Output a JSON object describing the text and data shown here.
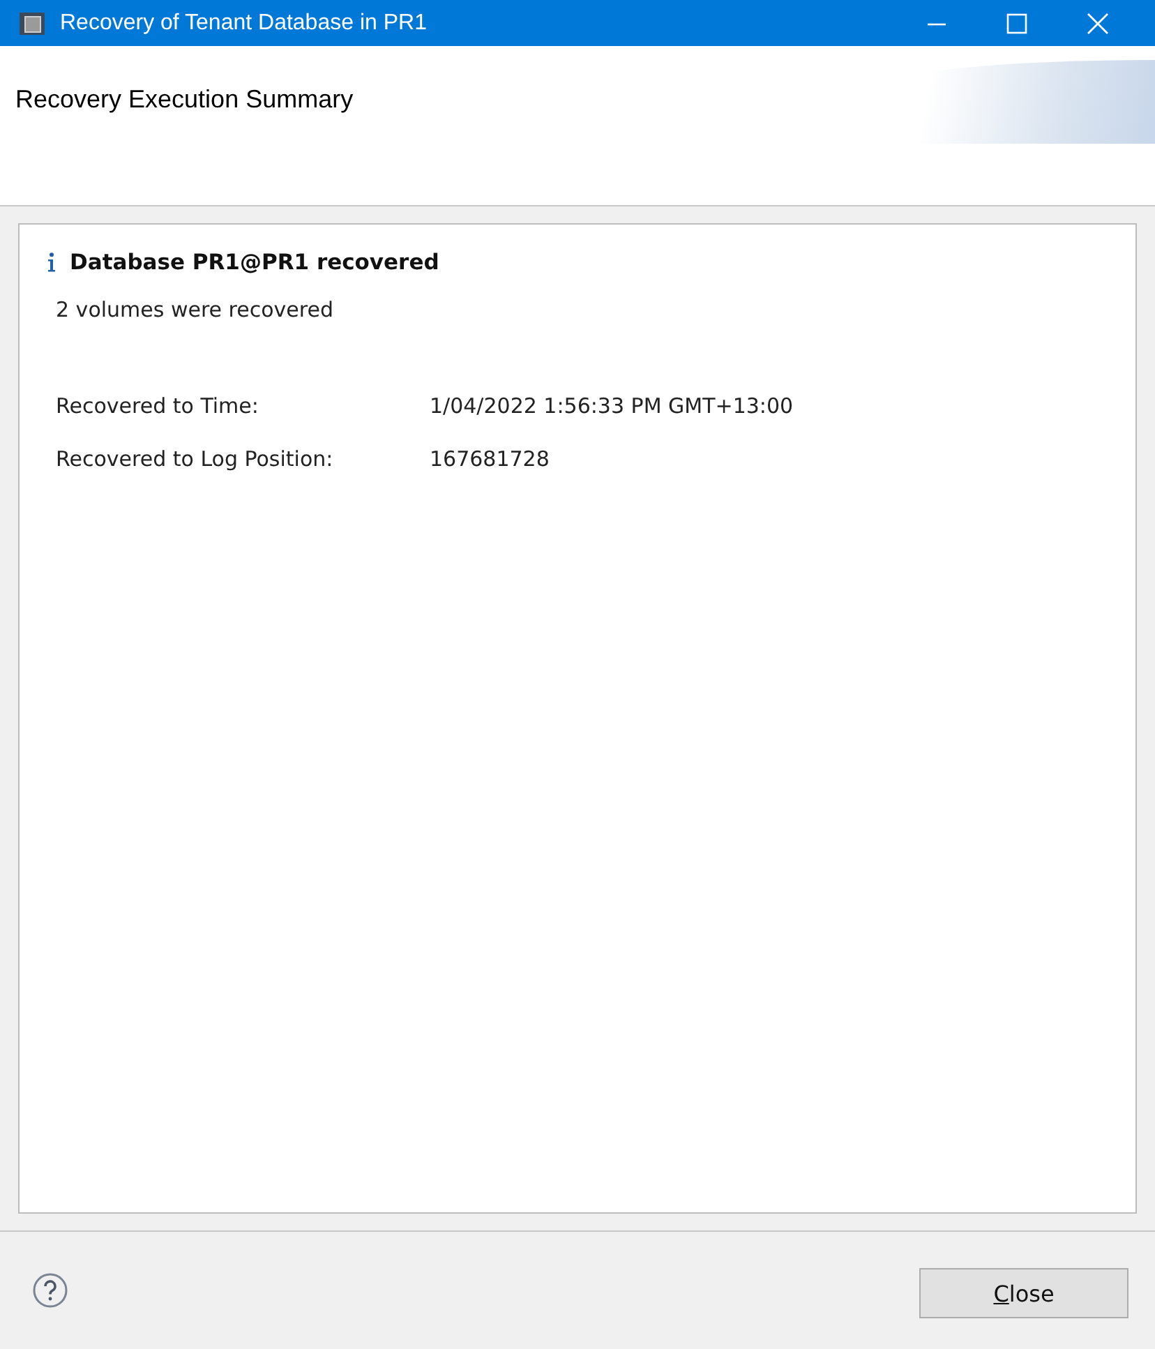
{
  "window": {
    "title": "Recovery of Tenant Database in PR1"
  },
  "header": {
    "title": "Recovery Execution Summary"
  },
  "summary": {
    "heading": "Database PR1@PR1 recovered",
    "message": "2 volumes were recovered",
    "details": [
      {
        "label": "Recovered to Time:",
        "value": "1/04/2022 1:56:33 PM GMT+13:00"
      },
      {
        "label": "Recovered to Log Position:",
        "value": "167681728"
      }
    ]
  },
  "buttons": [
    {
      "label": "Close"
    }
  ]
}
